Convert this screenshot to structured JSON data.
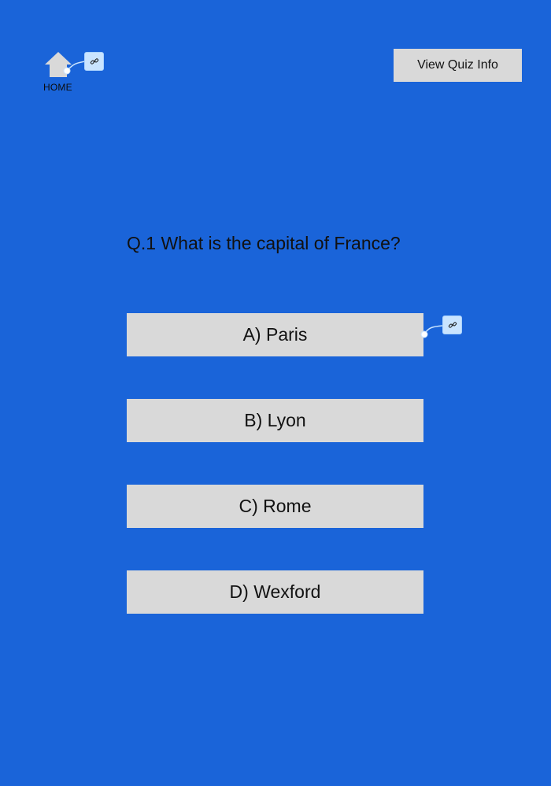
{
  "nav": {
    "home_label": "HOME",
    "home_icon": "house-icon",
    "info_button_label": "View Quiz Info"
  },
  "quiz": {
    "question": "Q.1 What is the capital of France?",
    "answers": [
      {
        "label": "A) Paris"
      },
      {
        "label": "B) Lyon"
      },
      {
        "label": "C) Rome"
      },
      {
        "label": "D) Wexford"
      }
    ]
  },
  "prototype_links": [
    {
      "icon": "link-icon"
    },
    {
      "icon": "link-icon"
    }
  ],
  "colors": {
    "background": "#1A64D9",
    "button": "#D9D9D9",
    "link_badge": "#C9E4FF",
    "text": "#111111"
  }
}
